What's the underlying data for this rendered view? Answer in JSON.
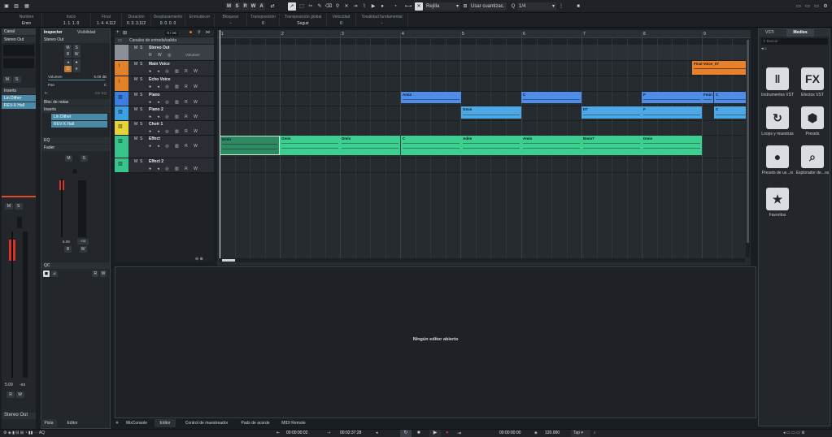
{
  "toolbar": {
    "modes": [
      "M",
      "S",
      "R",
      "W",
      "A"
    ],
    "snap_label": "Rejilla",
    "quantize_label": "Usar cuantizac.",
    "quantize_value": "1/4"
  },
  "info_line": [
    {
      "label": "Nombre",
      "value": "Emin"
    },
    {
      "label": "Inicio",
      "value": "1. 1. 1. 0"
    },
    {
      "label": "Final",
      "value": "1. 4. 4.112"
    },
    {
      "label": "Duración",
      "value": "0. 3. 3.112"
    },
    {
      "label": "Desplazamiento",
      "value": "0. 0. 0. 0"
    },
    {
      "label": "Enmudecer",
      "value": ""
    },
    {
      "label": "Bloquear",
      "value": "-"
    },
    {
      "label": "Transposición",
      "value": "0"
    },
    {
      "label": "Transposición global",
      "value": "Seguir"
    },
    {
      "label": "Velocidad",
      "value": "0"
    },
    {
      "label": "Tonalidad fundamental",
      "value": "-"
    }
  ],
  "channel": {
    "tab": "Canal",
    "output": "Stereo Out",
    "inserts_label": "Inserts",
    "inserts": [
      "Lin Dither",
      "REV-X Hall"
    ],
    "fader_value": "5.09",
    "fader_value2": "-oo",
    "footer": "Stereo Out"
  },
  "inspector": {
    "tabs": [
      "Inspector",
      "Visibilidad"
    ],
    "track": "Stereo Out",
    "volume_label": "Volumen",
    "volume_value": "5.09 dB",
    "pan_label": "Pan",
    "pan_value": "C",
    "sections": [
      "Bloc de notas",
      "Inserts",
      "EQ",
      "Fader",
      "QC"
    ],
    "inserts": [
      "Lin Dither",
      "REV-X Hall"
    ],
    "fader_db": "5.09",
    "fader_db2": "-oo",
    "eq_value": "Sin EQ"
  },
  "tracklist": {
    "header": "Canales de entrada/salida",
    "counter": "0 / 16",
    "tracks": [
      {
        "name": "Stereo Out",
        "color": "#7b8087",
        "volume_label": "Volumen"
      },
      {
        "name": "Main Voice",
        "color": "#e0822a"
      },
      {
        "name": "Echo Voice",
        "color": "#e0822a"
      },
      {
        "name": "Piano",
        "color": "#3b7fe0"
      },
      {
        "name": "Piano 2",
        "color": "#3b9fe0"
      },
      {
        "name": "Choir 1",
        "color": "#e6d33a"
      },
      {
        "name": "Effect",
        "color": "#38c48a"
      },
      {
        "name": "Effect 2",
        "color": "#38c48a"
      }
    ]
  },
  "ruler": [
    "1",
    "2",
    "3",
    "4",
    "5",
    "6",
    "7",
    "8",
    "9"
  ],
  "clips": {
    "main_voice": [
      {
        "label": "Final Voice_07"
      }
    ],
    "piano": [
      {
        "label": "Amin"
      },
      {
        "label": "C"
      },
      {
        "label": "F"
      },
      {
        "label": "Fmin"
      },
      {
        "label": "C"
      }
    ],
    "piano2": [
      {
        "label": "Gsus"
      },
      {
        "label": "D7"
      },
      {
        "label": "F"
      },
      {
        "label": "C"
      }
    ],
    "effect": [
      {
        "label": "Emin"
      },
      {
        "label": "Gmin"
      },
      {
        "label": "Dmin"
      },
      {
        "label": "C"
      },
      {
        "label": "Adim"
      },
      {
        "label": "Amin"
      },
      {
        "label": "Bmin7"
      },
      {
        "label": "Dmin"
      }
    ]
  },
  "editor": {
    "empty_text": "Ningún editor abierto"
  },
  "bottom_tabs": [
    "Pista",
    "Editor",
    "MixConsole",
    "Editor",
    "Control de muestreador",
    "Pads de acorde",
    "MIDI Remote"
  ],
  "transport": {
    "position_left": "00:00:00:02",
    "position_mid": "00:02:37:28",
    "position_right": "00:00:00:00",
    "tempo": "120.000",
    "tap": "Tap"
  },
  "media": {
    "tabs": [
      "VSTi",
      "Medios"
    ],
    "search_placeholder": "Buscar",
    "tiles": [
      {
        "label": "Instrumentos VST",
        "glyph": "‖"
      },
      {
        "label": "Efectos VST",
        "glyph": "FX"
      },
      {
        "label": "Loops y muestras",
        "glyph": "↻"
      },
      {
        "label": "Presets",
        "glyph": "⬢"
      },
      {
        "label": "Presets de us...io",
        "glyph": "●"
      },
      {
        "label": "Explorador de...os",
        "glyph": "⌕"
      },
      {
        "label": "Favoritos",
        "glyph": "★"
      }
    ]
  }
}
